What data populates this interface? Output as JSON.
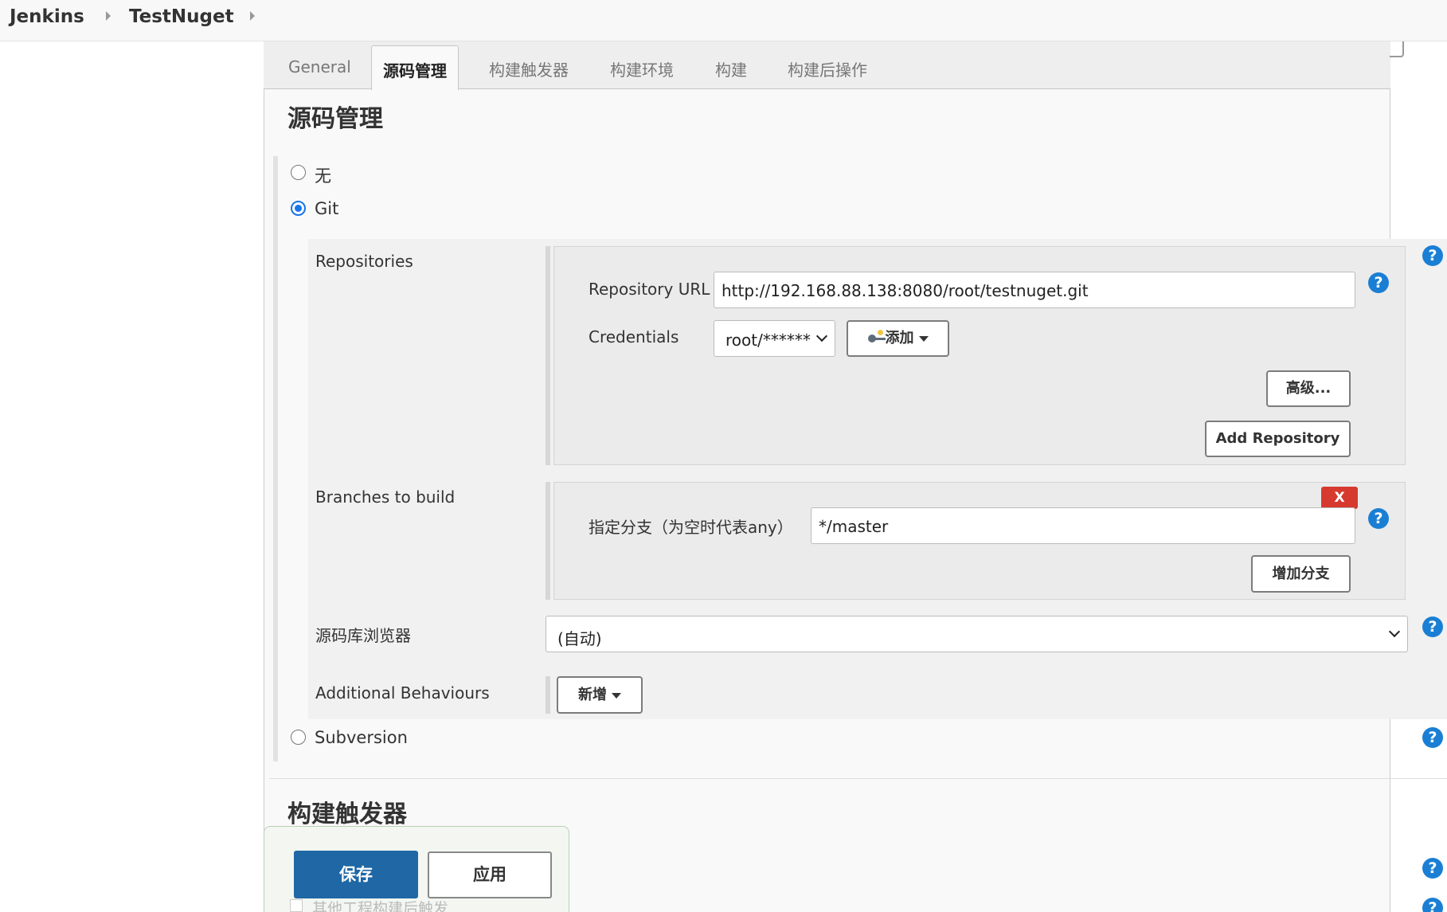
{
  "breadcrumb": {
    "root": "Jenkins",
    "project": "TestNuget"
  },
  "tabs": [
    {
      "label": "General"
    },
    {
      "label": "源码管理"
    },
    {
      "label": "构建触发器"
    },
    {
      "label": "构建环境"
    },
    {
      "label": "构建"
    },
    {
      "label": "构建后操作"
    }
  ],
  "scm": {
    "title": "源码管理",
    "option_none": "无",
    "option_git": "Git",
    "option_svn": "Subversion",
    "selected": "Git",
    "repositories_label": "Repositories",
    "repo_url_label": "Repository URL",
    "repo_url_value": "http://192.168.88.138:8080/root/testnuget.git",
    "credentials_label": "Credentials",
    "credentials_value": "root/******",
    "add_button": "添加",
    "advanced_button": "高级...",
    "add_repository_button": "Add Repository",
    "branches_label": "Branches to build",
    "branch_spec_label": "指定分支（为空时代表any）",
    "branch_spec_value": "*/master",
    "remove_button": "X",
    "add_branch_button": "增加分支",
    "browser_label": "源码库浏览器",
    "browser_value": "(自动)",
    "behaviours_label": "Additional Behaviours",
    "behaviours_button": "新增"
  },
  "triggers": {
    "title": "构建触发器",
    "partial_option": "其他工程构建后触发"
  },
  "help_glyph": "?",
  "actions": {
    "save": "保存",
    "apply": "应用"
  },
  "colors": {
    "primary": "#1f67a5",
    "help": "#1a7fd4",
    "danger": "#d63a2f",
    "radio": "#1a73e8"
  }
}
